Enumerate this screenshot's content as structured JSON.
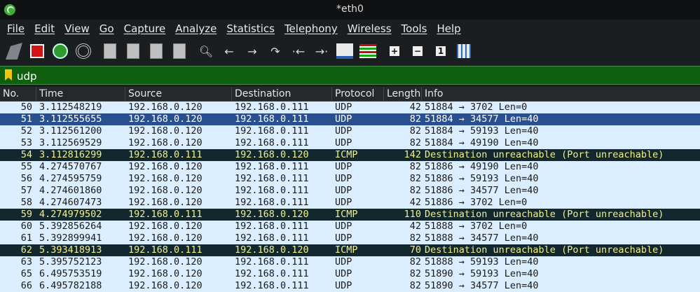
{
  "window": {
    "title": "*eth0"
  },
  "menu": [
    "File",
    "Edit",
    "View",
    "Go",
    "Capture",
    "Analyze",
    "Statistics",
    "Telephony",
    "Wireless",
    "Tools",
    "Help"
  ],
  "toolbar": {
    "icons": [
      "shark-start-icon",
      "stop-icon",
      "restart-icon",
      "capture-options-icon",
      "open-file-icon",
      "save-file-icon",
      "close-file-icon",
      "reload-icon",
      "find-icon",
      "back-icon",
      "forward-icon",
      "go-to-packet-icon",
      "first-packet-icon",
      "last-packet-icon",
      "autoscroll-icon",
      "colorize-icon",
      "zoom-in-icon",
      "zoom-out-icon",
      "normal-size-icon",
      "resize-columns-icon"
    ]
  },
  "filter": {
    "value": "udp"
  },
  "columns": [
    "No.",
    "Time",
    "Source",
    "Destination",
    "Protocol",
    "Length",
    "Info"
  ],
  "packets": [
    {
      "no": "50",
      "time": "3.112548219",
      "src": "192.168.0.120",
      "dst": "192.168.0.111",
      "proto": "UDP",
      "len": "42",
      "info": "51884 → 3702 Len=0",
      "style": "udp"
    },
    {
      "no": "51",
      "time": "3.112555655",
      "src": "192.168.0.120",
      "dst": "192.168.0.111",
      "proto": "UDP",
      "len": "82",
      "info": "51884 → 34577 Len=40",
      "style": "selected"
    },
    {
      "no": "52",
      "time": "3.112561200",
      "src": "192.168.0.120",
      "dst": "192.168.0.111",
      "proto": "UDP",
      "len": "82",
      "info": "51884 → 59193 Len=40",
      "style": "udp"
    },
    {
      "no": "53",
      "time": "3.112569529",
      "src": "192.168.0.120",
      "dst": "192.168.0.111",
      "proto": "UDP",
      "len": "82",
      "info": "51884 → 49190 Len=40",
      "style": "udp"
    },
    {
      "no": "54",
      "time": "3.112816299",
      "src": "192.168.0.111",
      "dst": "192.168.0.120",
      "proto": "ICMP",
      "len": "142",
      "info": "Destination unreachable (Port unreachable)",
      "style": "icmp"
    },
    {
      "no": "55",
      "time": "4.274570767",
      "src": "192.168.0.120",
      "dst": "192.168.0.111",
      "proto": "UDP",
      "len": "82",
      "info": "51886 → 49190 Len=40",
      "style": "udp"
    },
    {
      "no": "56",
      "time": "4.274595759",
      "src": "192.168.0.120",
      "dst": "192.168.0.111",
      "proto": "UDP",
      "len": "82",
      "info": "51886 → 59193 Len=40",
      "style": "udp"
    },
    {
      "no": "57",
      "time": "4.274601860",
      "src": "192.168.0.120",
      "dst": "192.168.0.111",
      "proto": "UDP",
      "len": "82",
      "info": "51886 → 34577 Len=40",
      "style": "udp"
    },
    {
      "no": "58",
      "time": "4.274607473",
      "src": "192.168.0.120",
      "dst": "192.168.0.111",
      "proto": "UDP",
      "len": "42",
      "info": "51886 → 3702 Len=0",
      "style": "udp"
    },
    {
      "no": "59",
      "time": "4.274979502",
      "src": "192.168.0.111",
      "dst": "192.168.0.120",
      "proto": "ICMP",
      "len": "110",
      "info": "Destination unreachable (Port unreachable)",
      "style": "icmp"
    },
    {
      "no": "60",
      "time": "5.392856264",
      "src": "192.168.0.120",
      "dst": "192.168.0.111",
      "proto": "UDP",
      "len": "42",
      "info": "51888 → 3702 Len=0",
      "style": "udp"
    },
    {
      "no": "61",
      "time": "5.392899941",
      "src": "192.168.0.120",
      "dst": "192.168.0.111",
      "proto": "UDP",
      "len": "82",
      "info": "51888 → 34577 Len=40",
      "style": "udp"
    },
    {
      "no": "62",
      "time": "5.393418913",
      "src": "192.168.0.111",
      "dst": "192.168.0.120",
      "proto": "ICMP",
      "len": "70",
      "info": "Destination unreachable (Port unreachable)",
      "style": "icmp"
    },
    {
      "no": "63",
      "time": "5.395752123",
      "src": "192.168.0.120",
      "dst": "192.168.0.111",
      "proto": "UDP",
      "len": "82",
      "info": "51888 → 59193 Len=40",
      "style": "udp"
    },
    {
      "no": "65",
      "time": "6.495753519",
      "src": "192.168.0.120",
      "dst": "192.168.0.111",
      "proto": "UDP",
      "len": "82",
      "info": "51890 → 59193 Len=40",
      "style": "udp"
    },
    {
      "no": "66",
      "time": "6.495782188",
      "src": "192.168.0.120",
      "dst": "192.168.0.111",
      "proto": "UDP",
      "len": "82",
      "info": "51890 → 34577 Len=40",
      "style": "udp"
    }
  ]
}
